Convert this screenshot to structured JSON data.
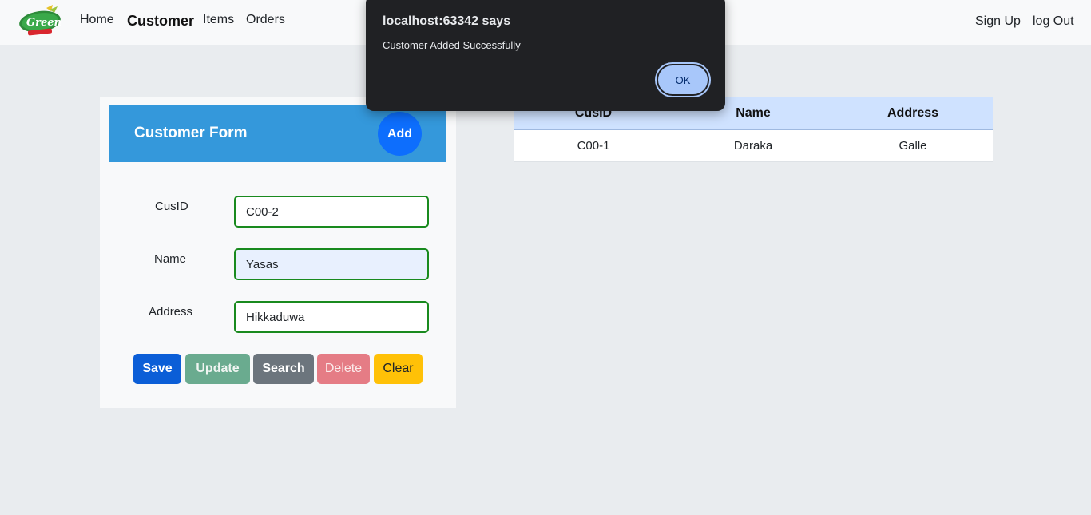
{
  "nav": {
    "logo_text": "The Green",
    "links": [
      "Home",
      "Customer",
      "Items",
      "Orders"
    ],
    "right": [
      "Sign Up",
      "log Out"
    ]
  },
  "form": {
    "title": "Customer Form",
    "add_label": "Add",
    "fields": [
      {
        "label": "CusID",
        "value": "C00-2"
      },
      {
        "label": "Name",
        "value": "Yasas"
      },
      {
        "label": "Address",
        "value": "Hikkaduwa"
      }
    ],
    "buttons": [
      "Save",
      "Update",
      "Search",
      "Delete",
      "Clear"
    ]
  },
  "table": {
    "headers": [
      "CusID",
      "Name",
      "Address"
    ],
    "rows": [
      [
        "C00-1",
        "Daraka",
        "Galle"
      ]
    ]
  },
  "dialog": {
    "title": "localhost:63342 says",
    "message": "Customer Added Successfully",
    "ok_label": "OK"
  },
  "colors": {
    "header_blue": "#3498db",
    "primary": "#0d6efd",
    "input_border": "#198a1e",
    "table_head": "#cfe2ff"
  }
}
